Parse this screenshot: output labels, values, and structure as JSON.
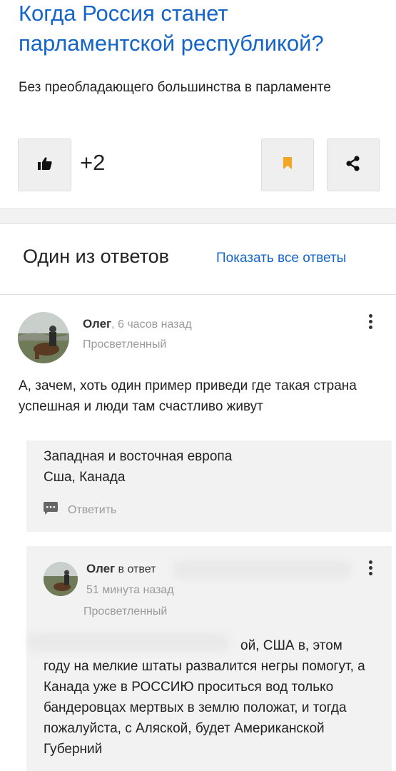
{
  "question": {
    "title": "Когда Россия станет парламентской республикой?",
    "subtitle": "Без преобладающего большинства в парламенте",
    "likes": "+2",
    "accent_color": "#1565c9",
    "bookmark_color": "#f5a623"
  },
  "answers_section": {
    "title": "Один из ответов",
    "show_all": "Показать все ответы"
  },
  "answer": {
    "author": "Олег",
    "time": ", 6 часов назад",
    "rank": "Просветленный",
    "text": "А, зачем, хоть один пример приведи где такая страна успешная и люди там счастливо живут"
  },
  "comment1": {
    "text_line1": "Западная и восточная европа",
    "text_line2": "Сша, Канада",
    "reply_label": "Ответить"
  },
  "comment2": {
    "author": "Олег",
    "in_reply": " в ответ",
    "time": "51 минута назад",
    "rank": "Просветленный",
    "text_first": "ой, США в, этом",
    "text_rest": "году на мелкие штаты развалится негры помогут, а Канада уже в РОССИЮ проситься вод только бандеровцах мертвых в землю положат, и тогда пожалуйста, с Аляской, будет Американской Губерний"
  }
}
